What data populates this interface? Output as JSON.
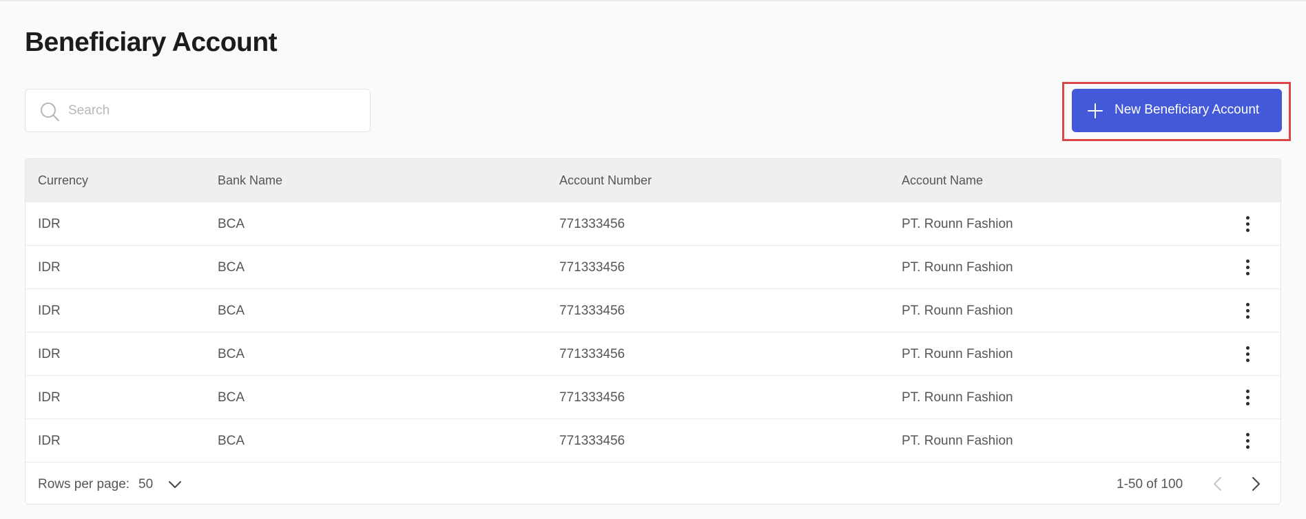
{
  "header": {
    "title": "Beneficiary Account"
  },
  "search": {
    "placeholder": "Search",
    "value": ""
  },
  "actions": {
    "new_button_label": "New Beneficiary Account"
  },
  "colors": {
    "primary": "#4359d8",
    "highlight": "#d9474b"
  },
  "table": {
    "columns": [
      "Currency",
      "Bank Name",
      "Account Number",
      "Account Name"
    ],
    "rows": [
      [
        "IDR",
        "BCA",
        "771333456",
        "PT. Rounn Fashion"
      ],
      [
        "IDR",
        "BCA",
        "771333456",
        "PT. Rounn Fashion"
      ],
      [
        "IDR",
        "BCA",
        "771333456",
        "PT. Rounn Fashion"
      ],
      [
        "IDR",
        "BCA",
        "771333456",
        "PT. Rounn Fashion"
      ],
      [
        "IDR",
        "BCA",
        "771333456",
        "PT. Rounn Fashion"
      ],
      [
        "IDR",
        "BCA",
        "771333456",
        "PT. Rounn Fashion"
      ]
    ]
  },
  "pagination": {
    "rows_per_page_label": "Rows per page:",
    "rows_per_page_value": "50",
    "range_text": "1-50 of 100"
  },
  "icons": [
    "search-icon",
    "plus-icon",
    "more-vertical-icon",
    "chevron-down-icon",
    "chevron-left-icon",
    "chevron-right-icon"
  ]
}
